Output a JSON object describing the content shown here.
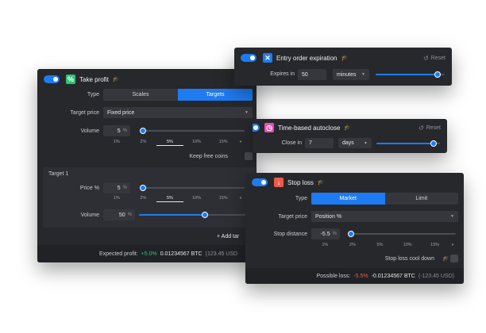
{
  "colors": {
    "accent": "#1e7bf2",
    "profit": "#33c176",
    "loss": "#ef5b4b",
    "panel_bg": "#26282c"
  },
  "take_profit": {
    "enabled": true,
    "icon": "percent-icon",
    "title": "Take profit",
    "help_icon": "graduation-cap-icon",
    "type_label": "Type",
    "type_options": [
      "Scales",
      "Targets"
    ],
    "type_selected": "Targets",
    "target_price_label": "Target price",
    "target_price_value": "Fixed price",
    "volume_label": "Volume",
    "volume_value": "5",
    "volume_unit": "%",
    "volume_ticks": [
      "1%",
      "2%",
      "5%",
      "10%",
      "15%"
    ],
    "volume_selected_tick": "5%",
    "volume_level": 0.0,
    "keep_free_coins_label": "Keep free coins",
    "target_title": "Target 1",
    "price_label": "Price %",
    "price_value": "5",
    "price_unit": "%",
    "price_ticks": [
      "1%",
      "2%",
      "5%",
      "10%",
      "15%"
    ],
    "price_selected_tick": "5%",
    "price_level": 0.0,
    "target_volume_label": "Volume",
    "target_volume_value": "50",
    "target_volume_unit": "%",
    "target_volume_level": 0.5,
    "add_target_label": "+ Add tar",
    "expected_profit_label": "Expected profit:",
    "expected_profit_pct": "+5.0%",
    "expected_profit_btc": "0.01234567 BTC",
    "expected_profit_usd": "(123.45 USD"
  },
  "entry_expiration": {
    "enabled": true,
    "icon": "close-icon",
    "title": "Entry order expiration",
    "help_icon": "graduation-cap-icon",
    "reset_label": "Reset",
    "expires_label": "Expires in",
    "expires_value": "50",
    "unit_value": "minutes",
    "slider_level": 0.9
  },
  "autoclose": {
    "enabled": true,
    "icon": "clock-icon",
    "title": "Time-based autoclose",
    "help_icon": "graduation-cap-icon",
    "reset_label": "Reset",
    "close_in_label": "Close in",
    "close_in_value": "7",
    "unit_value": "days",
    "slider_level": 0.9
  },
  "stop_loss": {
    "enabled": true,
    "icon": "arrow-down-icon",
    "title": "Stop loss",
    "help_icon": "graduation-cap-icon",
    "type_label": "Type",
    "type_options": [
      "Market",
      "Limit"
    ],
    "type_selected": "Market",
    "target_price_label": "Target price",
    "target_price_value": "Position %",
    "distance_label": "Stop distance",
    "distance_value": "-5.5",
    "distance_unit": "%",
    "distance_ticks": [
      "1%",
      "2%",
      "5%",
      "10%",
      "15%"
    ],
    "distance_level": 0.0,
    "cooldown_label": "Stop loss cool down",
    "possible_loss_label": "Possible loss:",
    "possible_loss_pct": "-5.5%",
    "possible_loss_btc": "-0.01234567 BTC",
    "possible_loss_usd": "(-123.45 USD)"
  }
}
